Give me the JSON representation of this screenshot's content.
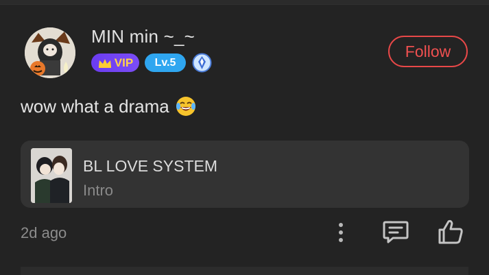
{
  "comment": {
    "user": {
      "name": "MIN min ~_~",
      "vip_label": "VIP",
      "level_label": "Lv.5",
      "avatar_icon": "halloween-character-avatar",
      "rank_icon": "diamond-rank-icon"
    },
    "follow_label": "Follow",
    "text": "wow what a drama",
    "emoji_icon": "laughing-with-tears-emoji",
    "book": {
      "title": "BL LOVE SYSTEM",
      "subtitle": "Intro",
      "cover_icon": "two-characters-cover"
    },
    "timestamp": "2d ago",
    "actions": {
      "more_icon": "vertical-dots-icon",
      "reply_icon": "comment-bubble-icon",
      "like_icon": "thumbs-up-icon"
    }
  },
  "colors": {
    "background": "#232323",
    "card": "#333333",
    "follow_accent": "#e84848",
    "vip_purple": "#6b3cf0",
    "level_blue": "#2fa6f0"
  }
}
